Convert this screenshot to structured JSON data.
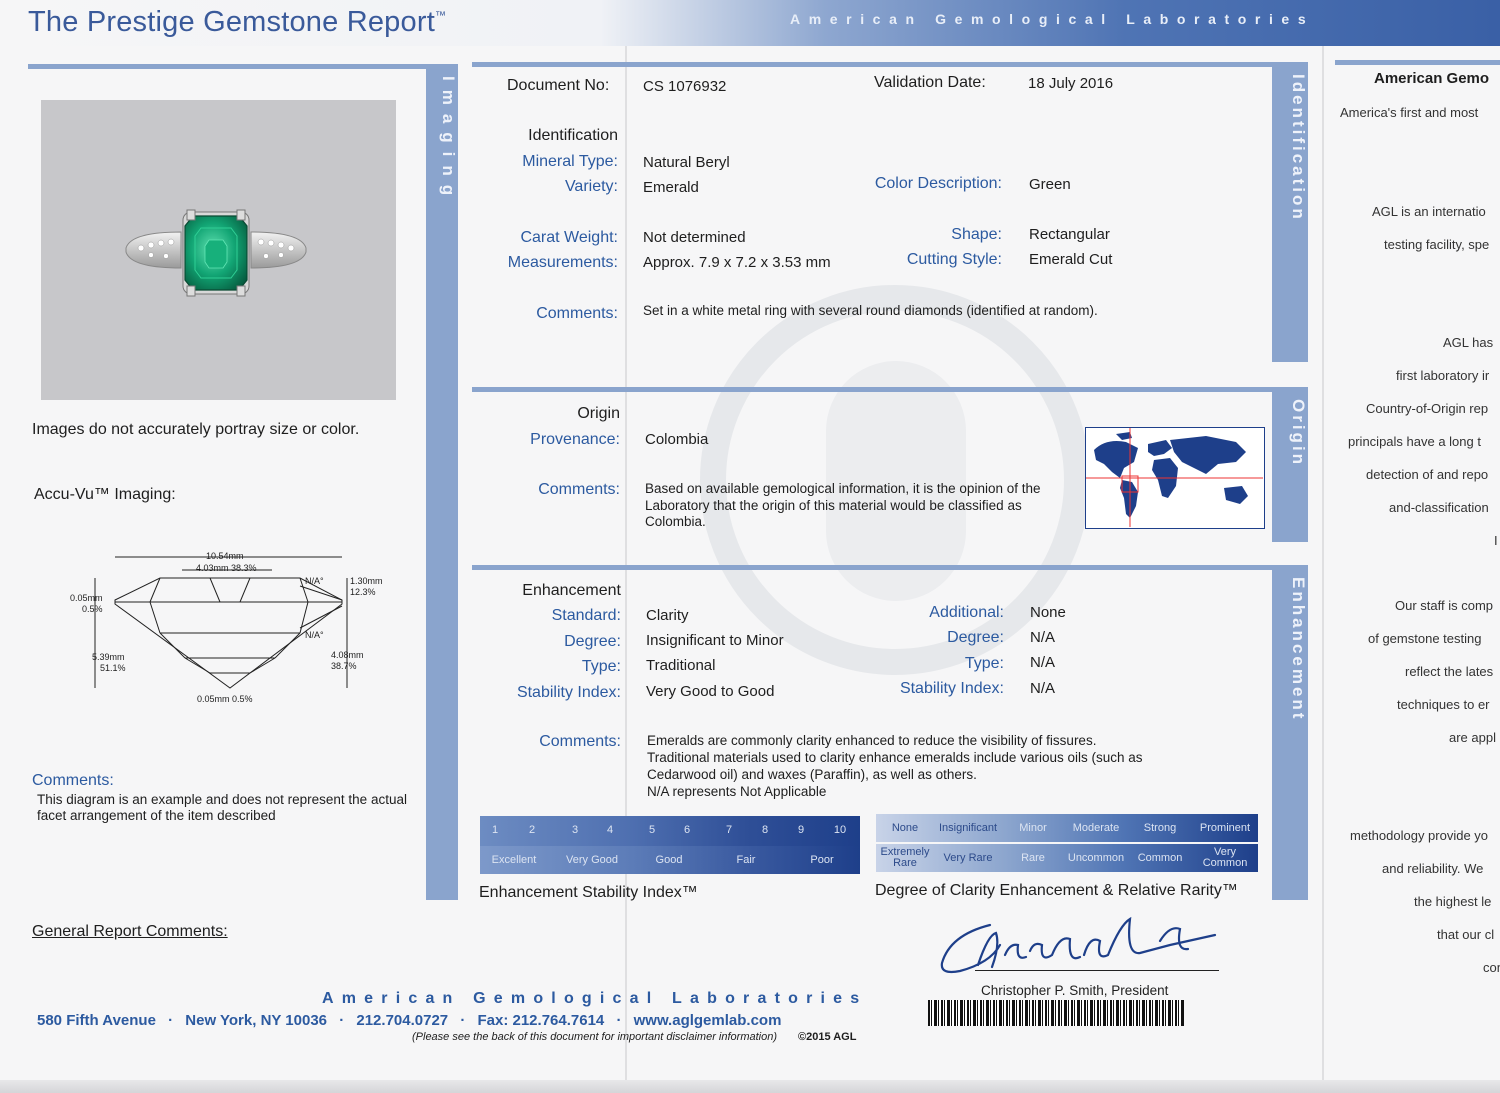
{
  "header": {
    "title": "The Prestige Gemstone Report",
    "tm": "™",
    "lab_banner": "American Gemological Laboratories"
  },
  "imaging": {
    "tab_label": "Imaging",
    "disclaimer": "Images do not accurately portray size or color.",
    "accuvu_label": "Accu-Vu™ Imaging:",
    "diagram": {
      "top_width": "10.54mm",
      "table_width": "4.03mm 38.3%",
      "girdle_left_mm": "0.05mm",
      "girdle_left_pct": "0.5%",
      "crown_na": "N/A°",
      "crown_height_mm": "1.30mm",
      "crown_height_pct": "12.3%",
      "pavilion_na": "N/A°",
      "total_depth_mm": "5.39mm",
      "total_depth_pct": "51.1%",
      "pavilion_depth_mm": "4.08mm",
      "pavilion_depth_pct": "38.7%",
      "culet": "0.05mm 0.5%"
    },
    "comments_label": "Comments:",
    "comments_text": "This diagram is an example and does not represent the actual facet arrangement of the item described"
  },
  "general": {
    "label": "General Report Comments:"
  },
  "footer": {
    "lab_name": "American Gemological Laboratories",
    "address": "580 Fifth Avenue",
    "city": "New York, NY 10036",
    "phone": "212.704.0727",
    "fax": "Fax: 212.764.7614",
    "web": "www.aglgemlab.com",
    "disclaimer": "(Please see the back of this document for important disclaimer information)",
    "copyright": "©2015 AGL",
    "sep": "·"
  },
  "document": {
    "doc_no_label": "Document No:",
    "doc_no": "CS 1076932",
    "validation_label": "Validation Date:",
    "validation_date": "18 July 2016"
  },
  "identification": {
    "tab_label": "Identification",
    "section_title": "Identification",
    "mineral_type_label": "Mineral Type:",
    "mineral_type": "Natural Beryl",
    "variety_label": "Variety:",
    "variety": "Emerald",
    "color_label": "Color Description:",
    "color": "Green",
    "carat_label": "Carat Weight:",
    "carat": "Not determined",
    "shape_label": "Shape:",
    "shape": "Rectangular",
    "measurements_label": "Measurements:",
    "measurements": "Approx. 7.9 x 7.2 x 3.53  mm",
    "cutting_label": "Cutting Style:",
    "cutting": "Emerald Cut",
    "comments_label": "Comments:",
    "comments": "Set in a white metal ring with several round diamonds (identified at random)."
  },
  "origin": {
    "tab_label": "Origin",
    "section_title": "Origin",
    "provenance_label": "Provenance:",
    "provenance": "Colombia",
    "comments_label": "Comments:",
    "comments": "Based on available gemological information, it is the opinion of the Laboratory that the origin of this material would be classified as Colombia."
  },
  "enhancement": {
    "tab_label": "Enhancement",
    "section_title": "Enhancement",
    "standard_label": "Standard:",
    "standard": "Clarity",
    "degree_label": "Degree:",
    "degree": "Insignificant to Minor",
    "type_label": "Type:",
    "type": "Traditional",
    "stability_label": "Stability Index:",
    "stability": "Very Good to Good",
    "additional_label": "Additional:",
    "additional": "None",
    "add_degree_label": "Degree:",
    "add_degree": "N/A",
    "add_type_label": "Type:",
    "add_type": "N/A",
    "add_stability_label": "Stability Index:",
    "add_stability": "N/A",
    "comments_label": "Comments:",
    "comments_lines": [
      "Emeralds are commonly clarity enhanced to reduce the visibility of fissures.",
      "Traditional materials used to clarity enhance emeralds include various oils (such as",
      "Cedarwood oil) and waxes (Paraffin), as well as others.",
      "N/A represents Not Applicable"
    ]
  },
  "stability_scale": {
    "numbers": [
      "1",
      "2",
      "3",
      "4",
      "5",
      "6",
      "7",
      "8",
      "9",
      "10"
    ],
    "grades": [
      "Excellent",
      "Very Good",
      "Good",
      "Fair",
      "Poor"
    ],
    "caption": "Enhancement Stability Index™"
  },
  "rarity_scale": {
    "degrees": [
      "None",
      "Insignificant",
      "Minor",
      "Moderate",
      "Strong",
      "Prominent"
    ],
    "rarity": [
      "Extremely Rare",
      "Very Rare",
      "Rare",
      "Uncommon",
      "Common",
      "Very Common"
    ],
    "caption": "Degree of Clarity Enhancement & Relative Rarity™"
  },
  "signature": {
    "name": "Christopher P. Smith, President"
  },
  "right_page": {
    "heading": "American Gemo",
    "lines": [
      "America's first and most",
      "AGL is an internatio",
      "testing facility, spe",
      "AGL has",
      "first laboratory ir",
      "Country-of-Origin rep",
      "principals have a long t",
      "detection of and repo",
      "and-classification",
      "I",
      "Our staff is comp",
      "of gemstone testing",
      "reflect the lates",
      "techniques to er",
      "are appl",
      "methodology provide yo",
      "and reliability.  We",
      "the highest le",
      "that our cl",
      "con"
    ]
  },
  "colors": {
    "brand_blue": "#2c5aa0",
    "tab_blue": "#8aa4cd",
    "dark_navy": "#1e3f8a",
    "emerald": "#0e9f6e"
  }
}
